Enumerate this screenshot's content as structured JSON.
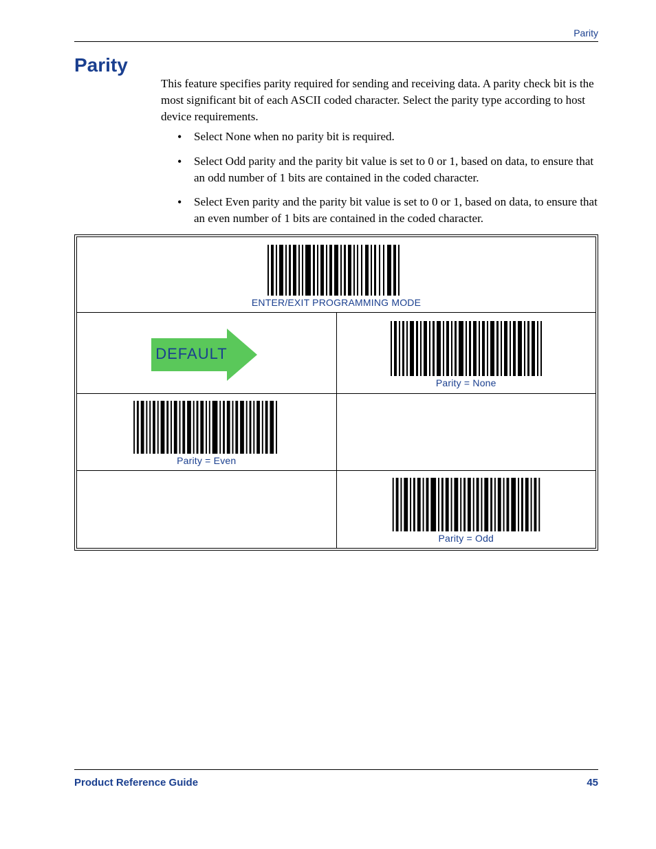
{
  "header": {
    "running": "Parity"
  },
  "section": {
    "title": "Parity"
  },
  "intro": "This feature specifies parity required for sending and receiving data. A parity check bit is the most significant bit of each ASCII coded character. Select the parity type according to host device requirements.",
  "bullets": [
    "Select None when no parity bit is required.",
    "Select Odd parity and the parity bit value is set to 0 or 1, based on data, to ensure that an odd number of 1 bits are contained in the coded character.",
    "Select Even parity and the parity bit value is set to 0 or 1, based on data, to ensure that an even number of 1 bits are contained in the coded character."
  ],
  "barcodes": {
    "enterexit": {
      "caption": "ENTER/EXIT PROGRAMMING MODE"
    },
    "default_label": "DEFAULT",
    "none": {
      "caption": "Parity = None"
    },
    "even": {
      "caption": "Parity = Even"
    },
    "odd": {
      "caption": "Parity = Odd"
    }
  },
  "footer": {
    "left": "Product Reference Guide",
    "right": "45"
  }
}
